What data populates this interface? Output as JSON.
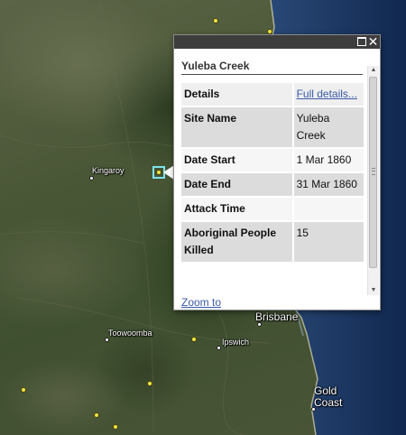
{
  "map": {
    "places": [
      {
        "label": "Kingaroy",
        "name": "place-kingaroy"
      },
      {
        "label": "Toowoomba",
        "name": "place-toowoomba"
      },
      {
        "label": "Ipswich",
        "name": "place-ipswich"
      },
      {
        "label": "Brisbane",
        "name": "place-brisbane"
      },
      {
        "label": "Gold Coast",
        "name": "place-gold-coast"
      }
    ],
    "marker_color": "#f1e640",
    "selected_outline_color": "#7ee3ee"
  },
  "popup": {
    "title": "Yuleba Creek",
    "rows": [
      {
        "key": "Details",
        "value": "Full details...",
        "is_link": true
      },
      {
        "key": "Site Name",
        "value": "Yuleba Creek"
      },
      {
        "key": "Date Start",
        "value": "1 Mar 1860"
      },
      {
        "key": "Date End",
        "value": "31 Mar 1860"
      },
      {
        "key": "Attack Time",
        "value": ""
      },
      {
        "key": "Aboriginal People Killed",
        "value": "15"
      }
    ],
    "zoom_label": "Zoom to",
    "maximize_icon": "maximize-icon",
    "close_icon": "close-icon",
    "close_glyph": "✕"
  }
}
